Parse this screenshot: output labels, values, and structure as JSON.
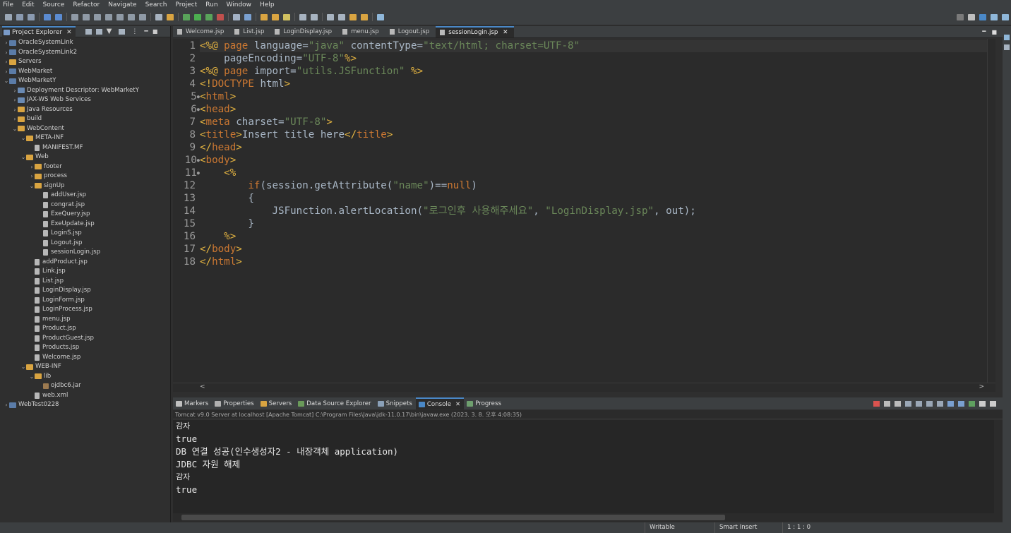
{
  "menu": [
    "File",
    "Edit",
    "Source",
    "Refactor",
    "Navigate",
    "Search",
    "Project",
    "Run",
    "Window",
    "Help"
  ],
  "explorer": {
    "title": "Project Explorer",
    "tree": [
      {
        "label": "OracleSystemLink",
        "depth": 0,
        "kind": "proj",
        "arrow": ">"
      },
      {
        "label": "OracleSystemLink2",
        "depth": 0,
        "kind": "proj",
        "arrow": ">"
      },
      {
        "label": "Servers",
        "depth": 0,
        "kind": "folder",
        "arrow": ">"
      },
      {
        "label": "WebMarket",
        "depth": 0,
        "kind": "proj",
        "arrow": ">"
      },
      {
        "label": "WebMarketY",
        "depth": 0,
        "kind": "proj",
        "arrow": "v"
      },
      {
        "label": "Deployment Descriptor: WebMarketY",
        "depth": 1,
        "kind": "desc",
        "arrow": ">"
      },
      {
        "label": "JAX-WS Web Services",
        "depth": 1,
        "kind": "desc",
        "arrow": ">"
      },
      {
        "label": "Java Resources",
        "depth": 1,
        "kind": "folder",
        "arrow": ">"
      },
      {
        "label": "build",
        "depth": 1,
        "kind": "folder",
        "arrow": ">"
      },
      {
        "label": "WebContent",
        "depth": 1,
        "kind": "folder",
        "arrow": "v"
      },
      {
        "label": "META-INF",
        "depth": 2,
        "kind": "folder",
        "arrow": "v"
      },
      {
        "label": "MANIFEST.MF",
        "depth": 3,
        "kind": "file",
        "arrow": ""
      },
      {
        "label": "Web",
        "depth": 2,
        "kind": "folder",
        "arrow": "v"
      },
      {
        "label": "footer",
        "depth": 3,
        "kind": "folder",
        "arrow": ">"
      },
      {
        "label": "process",
        "depth": 3,
        "kind": "folder",
        "arrow": ">"
      },
      {
        "label": "signUp",
        "depth": 3,
        "kind": "folder",
        "arrow": "v"
      },
      {
        "label": "addUser.jsp",
        "depth": 4,
        "kind": "file",
        "arrow": ""
      },
      {
        "label": "congrat.jsp",
        "depth": 4,
        "kind": "file",
        "arrow": ""
      },
      {
        "label": "ExeQuery.jsp",
        "depth": 4,
        "kind": "file",
        "arrow": ""
      },
      {
        "label": "ExeUpdate.jsp",
        "depth": 4,
        "kind": "file",
        "arrow": ""
      },
      {
        "label": "LoginS.jsp",
        "depth": 4,
        "kind": "file",
        "arrow": ""
      },
      {
        "label": "Logout.jsp",
        "depth": 4,
        "kind": "file",
        "arrow": ""
      },
      {
        "label": "sessionLogin.jsp",
        "depth": 4,
        "kind": "file",
        "arrow": ""
      },
      {
        "label": "addProduct.jsp",
        "depth": 3,
        "kind": "file",
        "arrow": ""
      },
      {
        "label": "Link.jsp",
        "depth": 3,
        "kind": "file",
        "arrow": ""
      },
      {
        "label": "List.jsp",
        "depth": 3,
        "kind": "file",
        "arrow": ""
      },
      {
        "label": "LoginDisplay.jsp",
        "depth": 3,
        "kind": "file",
        "arrow": ""
      },
      {
        "label": "LoginForm.jsp",
        "depth": 3,
        "kind": "file",
        "arrow": ""
      },
      {
        "label": "LoginProcess.jsp",
        "depth": 3,
        "kind": "file",
        "arrow": ""
      },
      {
        "label": "menu.jsp",
        "depth": 3,
        "kind": "file",
        "arrow": ""
      },
      {
        "label": "Product.jsp",
        "depth": 3,
        "kind": "file",
        "arrow": ""
      },
      {
        "label": "ProductGuest.jsp",
        "depth": 3,
        "kind": "file",
        "arrow": ""
      },
      {
        "label": "Products.jsp",
        "depth": 3,
        "kind": "file",
        "arrow": ""
      },
      {
        "label": "Welcome.jsp",
        "depth": 3,
        "kind": "file",
        "arrow": ""
      },
      {
        "label": "WEB-INF",
        "depth": 2,
        "kind": "folder",
        "arrow": "v"
      },
      {
        "label": "lib",
        "depth": 3,
        "kind": "folder",
        "arrow": "v"
      },
      {
        "label": "ojdbc6.jar",
        "depth": 4,
        "kind": "jar",
        "arrow": ""
      },
      {
        "label": "web.xml",
        "depth": 3,
        "kind": "file",
        "arrow": ""
      },
      {
        "label": "WebTest0228",
        "depth": 0,
        "kind": "proj",
        "arrow": ">"
      }
    ]
  },
  "editor": {
    "tabs": [
      {
        "label": "Welcome.jsp",
        "active": false
      },
      {
        "label": "List.jsp",
        "active": false
      },
      {
        "label": "LoginDisplay.jsp",
        "active": false
      },
      {
        "label": "menu.jsp",
        "active": false
      },
      {
        "label": "Logout.jsp",
        "active": false
      },
      {
        "label": "sessionLogin.jsp",
        "active": true
      }
    ],
    "lines": [
      {
        "n": "1",
        "fold": false,
        "parts": [
          [
            "tg",
            "<%@ "
          ],
          [
            "kw",
            "page "
          ],
          [
            "at",
            "language="
          ],
          [
            "st",
            "\"java\" "
          ],
          [
            "at",
            "contentType="
          ],
          [
            "st",
            "\"text/html; charset=UTF-8\""
          ]
        ]
      },
      {
        "n": "2",
        "fold": false,
        "parts": [
          [
            "at",
            "    pageEncoding="
          ],
          [
            "st",
            "\"UTF-8\""
          ],
          [
            "tg",
            "%>"
          ]
        ]
      },
      {
        "n": "3",
        "fold": false,
        "parts": [
          [
            "tg",
            "<%@ "
          ],
          [
            "kw",
            "page "
          ],
          [
            "at",
            "import="
          ],
          [
            "st",
            "\"utils.JSFunction\" "
          ],
          [
            "tg",
            "%>"
          ]
        ]
      },
      {
        "n": "4",
        "fold": false,
        "parts": [
          [
            "tg",
            "<!"
          ],
          [
            "kw",
            "DOCTYPE "
          ],
          [
            "at",
            "html"
          ],
          [
            "tg",
            ">"
          ]
        ]
      },
      {
        "n": "5",
        "fold": true,
        "parts": [
          [
            "tg",
            "<"
          ],
          [
            "kw",
            "html"
          ],
          [
            "tg",
            ">"
          ]
        ]
      },
      {
        "n": "6",
        "fold": true,
        "parts": [
          [
            "tg",
            "<"
          ],
          [
            "kw",
            "head"
          ],
          [
            "tg",
            ">"
          ]
        ]
      },
      {
        "n": "7",
        "fold": false,
        "parts": [
          [
            "tg",
            "<"
          ],
          [
            "kw",
            "meta "
          ],
          [
            "at",
            "charset="
          ],
          [
            "st",
            "\"UTF-8\""
          ],
          [
            "tg",
            ">"
          ]
        ]
      },
      {
        "n": "8",
        "fold": false,
        "parts": [
          [
            "tg",
            "<"
          ],
          [
            "kw",
            "title"
          ],
          [
            "tg",
            ">"
          ],
          [
            "at",
            "Insert title here"
          ],
          [
            "tg",
            "</"
          ],
          [
            "kw",
            "title"
          ],
          [
            "tg",
            ">"
          ]
        ]
      },
      {
        "n": "9",
        "fold": false,
        "parts": [
          [
            "tg",
            "</"
          ],
          [
            "kw",
            "head"
          ],
          [
            "tg",
            ">"
          ]
        ]
      },
      {
        "n": "10",
        "fold": true,
        "parts": [
          [
            "tg",
            "<"
          ],
          [
            "kw",
            "body"
          ],
          [
            "tg",
            ">"
          ]
        ]
      },
      {
        "n": "11",
        "fold": true,
        "parts": [
          [
            "at",
            "    "
          ],
          [
            "tg",
            "<%"
          ]
        ]
      },
      {
        "n": "12",
        "fold": false,
        "parts": [
          [
            "at",
            "        "
          ],
          [
            "kw",
            "if"
          ],
          [
            "at",
            "(session.getAttribute("
          ],
          [
            "st",
            "\"name\""
          ],
          [
            "at",
            ")=="
          ],
          [
            "kw",
            "null"
          ],
          [
            "at",
            ")"
          ]
        ]
      },
      {
        "n": "13",
        "fold": false,
        "parts": [
          [
            "at",
            "        {"
          ]
        ]
      },
      {
        "n": "14",
        "fold": false,
        "parts": [
          [
            "at",
            "            JSFunction.alertLocation("
          ],
          [
            "st",
            "\"로그인후 사용해주세요\""
          ],
          [
            "at",
            ", "
          ],
          [
            "st",
            "\"LoginDisplay.jsp\""
          ],
          [
            "at",
            ", out);"
          ]
        ]
      },
      {
        "n": "15",
        "fold": false,
        "parts": [
          [
            "at",
            "        }"
          ]
        ]
      },
      {
        "n": "16",
        "fold": false,
        "parts": [
          [
            "at",
            "    "
          ],
          [
            "tg",
            "%>"
          ]
        ]
      },
      {
        "n": "17",
        "fold": false,
        "parts": [
          [
            "tg",
            "</"
          ],
          [
            "kw",
            "body"
          ],
          [
            "tg",
            ">"
          ]
        ]
      },
      {
        "n": "18",
        "fold": false,
        "parts": [
          [
            "tg",
            "</"
          ],
          [
            "kw",
            "html"
          ],
          [
            "tg",
            ">"
          ]
        ]
      }
    ]
  },
  "console": {
    "tabs": [
      {
        "label": "Markers",
        "active": false,
        "color": "#c0c0c0"
      },
      {
        "label": "Properties",
        "active": false,
        "color": "#b0b0b0"
      },
      {
        "label": "Servers",
        "active": false,
        "color": "#d9a441"
      },
      {
        "label": "Data Source Explorer",
        "active": false,
        "color": "#6a9a5a"
      },
      {
        "label": "Snippets",
        "active": false,
        "color": "#8aa0b8"
      },
      {
        "label": "Console",
        "active": true,
        "color": "#4a88c7"
      },
      {
        "label": "Progress",
        "active": false,
        "color": "#6fa06f"
      }
    ],
    "info": "Tomcat v9.0 Server at localhost [Apache Tomcat] C:\\Program Files\\Java\\jdk-11.0.17\\bin\\javaw.exe  (2023. 3. 8. 오후 4:08:35)",
    "lines": [
      "감자",
      "true",
      "DB 연결 성공(인수생성자2 - 내장객체 application)",
      "JDBC 자원 해제",
      "감자",
      "true"
    ]
  },
  "status": {
    "writable": "Writable",
    "insert": "Smart Insert",
    "position": "1 : 1 : 0"
  }
}
